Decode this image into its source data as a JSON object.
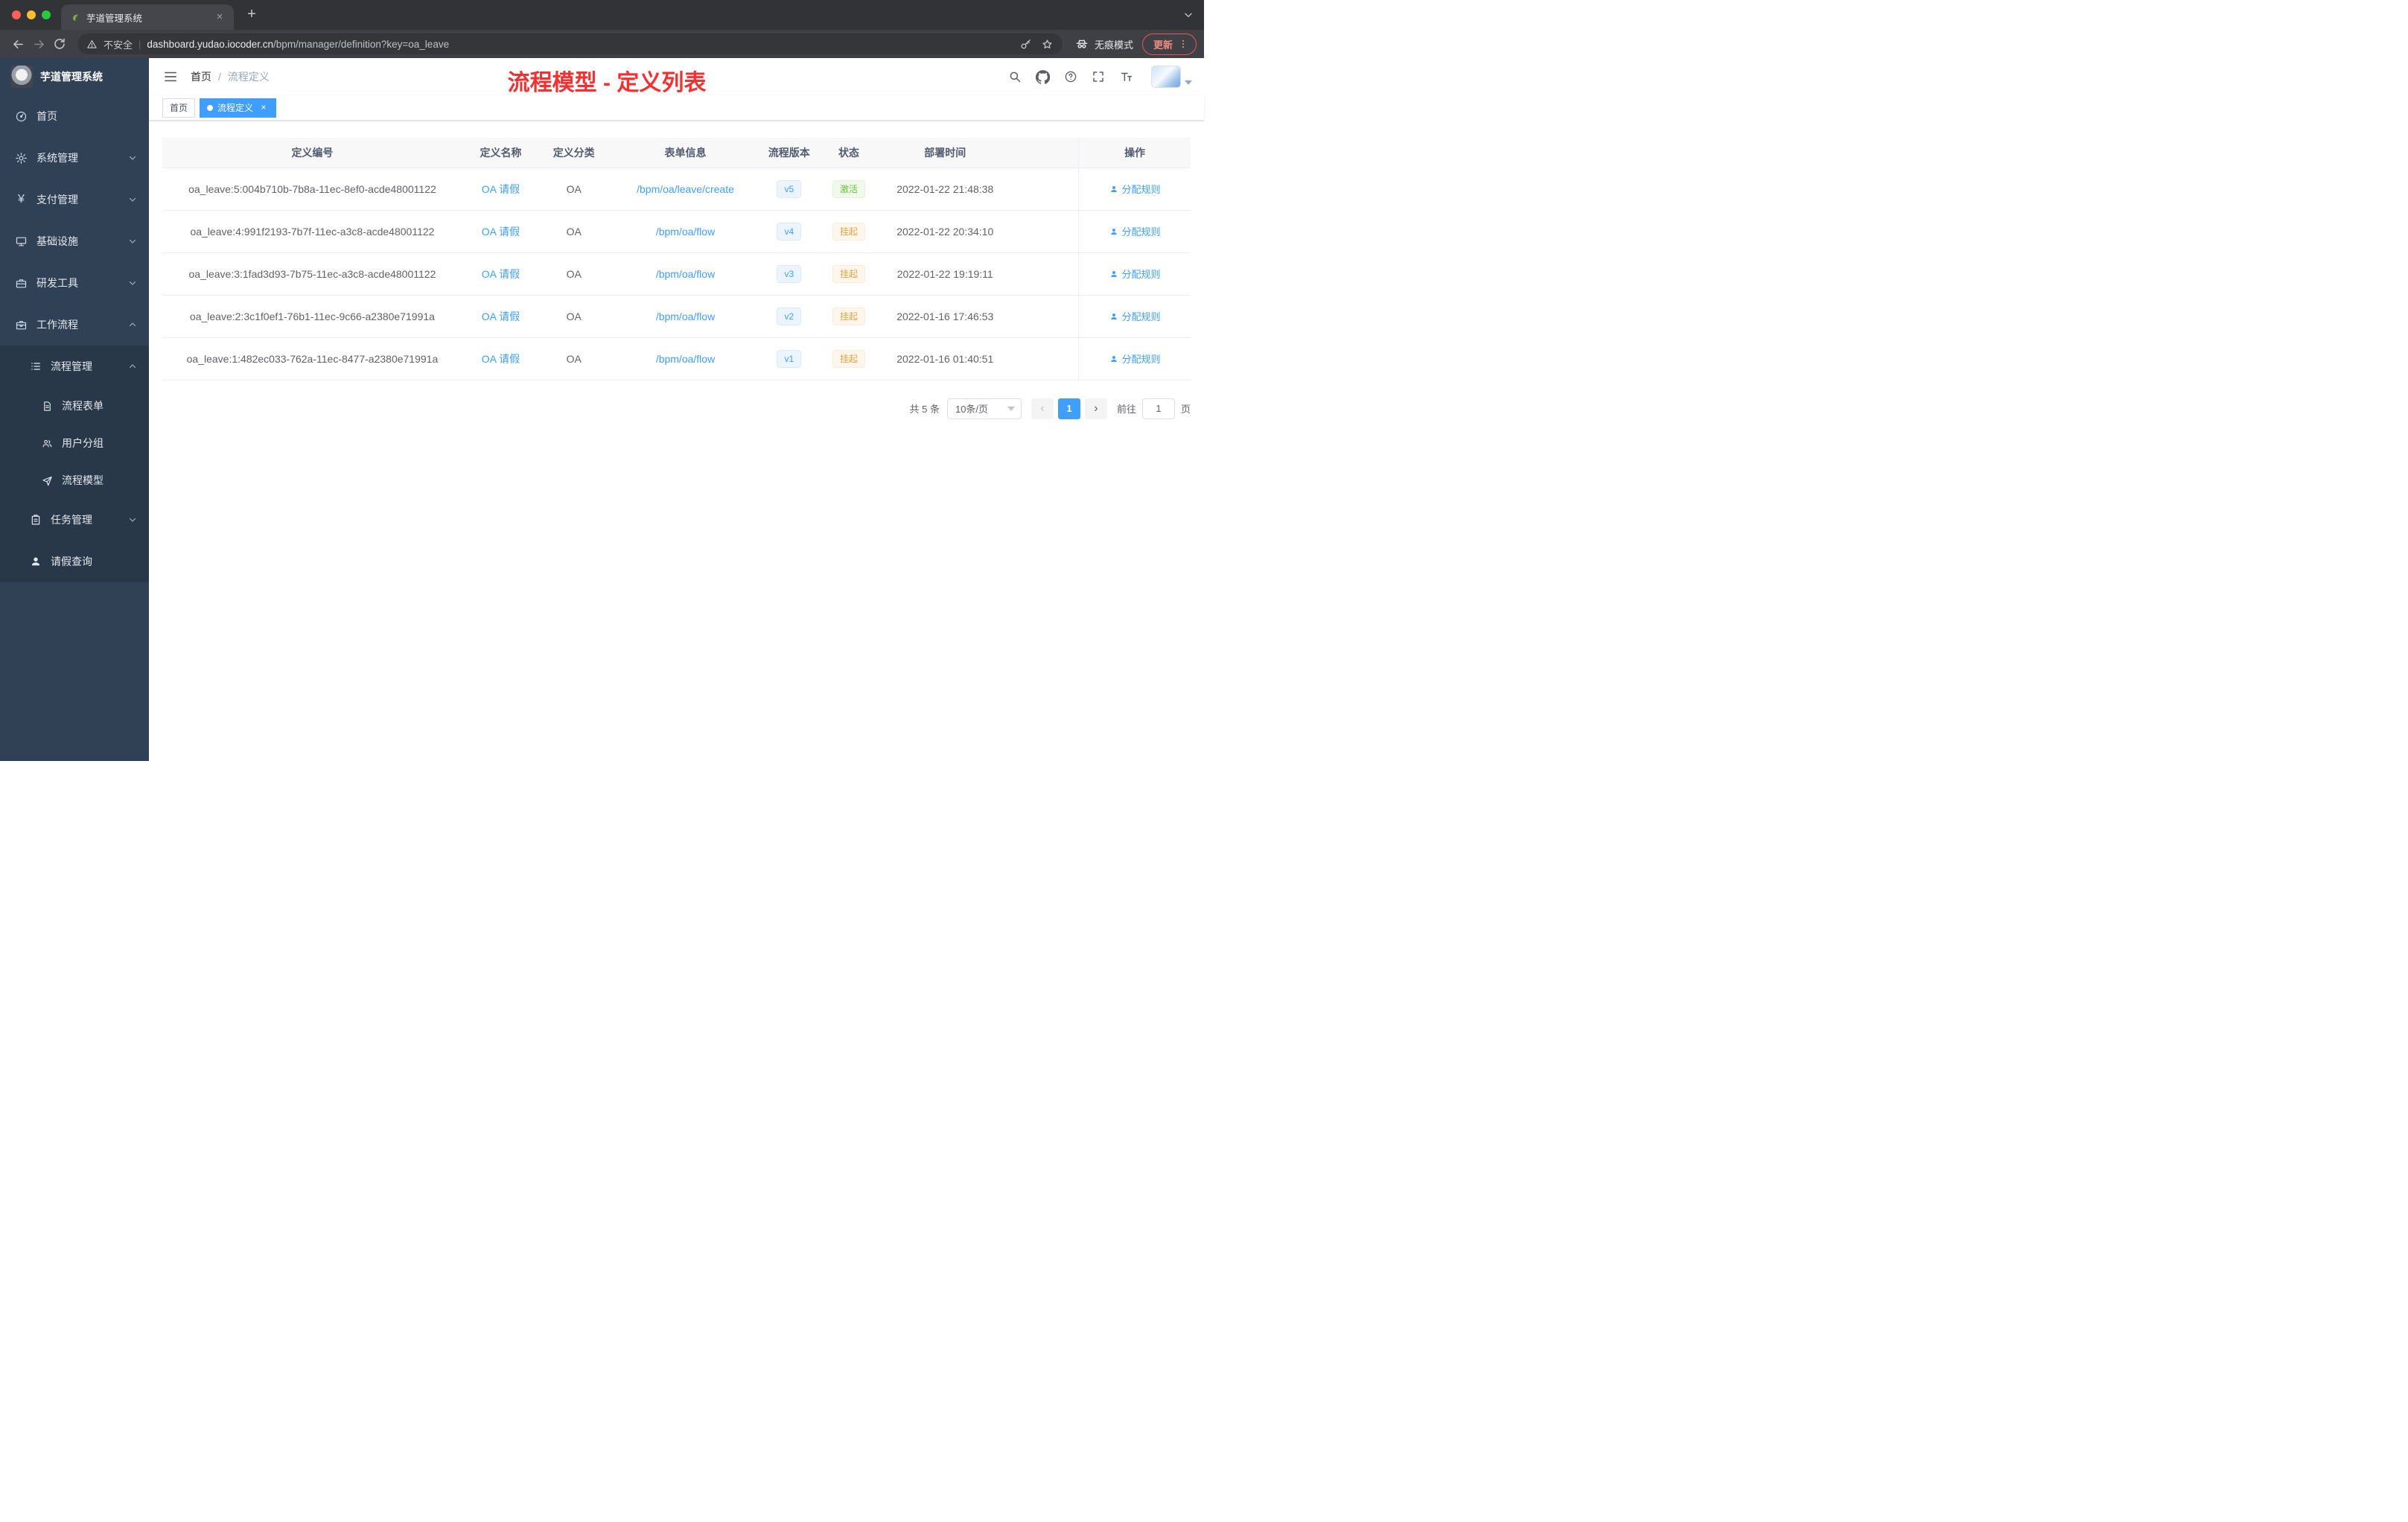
{
  "colors": {
    "accent": "#409eff",
    "success": "#67c23a",
    "warning": "#e6a23c",
    "annotation_red": "#f43030",
    "sidebar_bg": "#304156",
    "submenu_bg": "#283848"
  },
  "browser": {
    "traffic_lights": [
      "#ff5f57",
      "#febc2e",
      "#28c840"
    ],
    "tab_title": "芋道管理系统",
    "close_icon": "×",
    "new_tab_icon": "+",
    "security_label": "不安全",
    "separator": "|",
    "url_host": "dashboard.yudao.iocoder.cn",
    "url_path": "/bpm/manager/definition?key=oa_leave",
    "incognito_label": "无痕模式",
    "update_label": "更新"
  },
  "sidebar": {
    "brand": "芋道管理系统",
    "menu": [
      {
        "label": "首页"
      },
      {
        "label": "系统管理"
      },
      {
        "label": "支付管理"
      },
      {
        "label": "基础设施"
      },
      {
        "label": "研发工具"
      },
      {
        "label": "工作流程"
      }
    ],
    "yen_symbol": "¥",
    "submenu": {
      "process_management": "流程管理",
      "children": [
        {
          "label": "流程表单"
        },
        {
          "label": "用户分组"
        },
        {
          "label": "流程模型"
        }
      ],
      "task_management": "任务管理",
      "leave_query": "请假查询"
    }
  },
  "navbar": {
    "breadcrumb_home": "首页",
    "breadcrumb_separator": "/",
    "breadcrumb_current": "流程定义",
    "annotation": "流程模型 - 定义列表"
  },
  "tags": {
    "home": "首页",
    "active": "流程定义",
    "close_icon": "×"
  },
  "table": {
    "columns": [
      "定义编号",
      "定义名称",
      "定义分类",
      "表单信息",
      "流程版本",
      "状态",
      "部署时间",
      "操作"
    ],
    "rows": [
      {
        "id": "oa_leave:5:004b710b-7b8a-11ec-8ef0-acde48001122",
        "name": "OA 请假",
        "category": "OA",
        "form": "/bpm/oa/leave/create",
        "version": "v5",
        "status": "激活",
        "time": "2022-01-22 21:48:38",
        "action": "分配规则"
      },
      {
        "id": "oa_leave:4:991f2193-7b7f-11ec-a3c8-acde48001122",
        "name": "OA 请假",
        "category": "OA",
        "form": "/bpm/oa/flow",
        "version": "v4",
        "status": "挂起",
        "time": "2022-01-22 20:34:10",
        "action": "分配规则"
      },
      {
        "id": "oa_leave:3:1fad3d93-7b75-11ec-a3c8-acde48001122",
        "name": "OA 请假",
        "category": "OA",
        "form": "/bpm/oa/flow",
        "version": "v3",
        "status": "挂起",
        "time": "2022-01-22 19:19:11",
        "action": "分配规则"
      },
      {
        "id": "oa_leave:2:3c1f0ef1-76b1-11ec-9c66-a2380e71991a",
        "name": "OA 请假",
        "category": "OA",
        "form": "/bpm/oa/flow",
        "version": "v2",
        "status": "挂起",
        "time": "2022-01-16 17:46:53",
        "action": "分配规则"
      },
      {
        "id": "oa_leave:1:482ec033-762a-11ec-8477-a2380e71991a",
        "name": "OA 请假",
        "category": "OA",
        "form": "/bpm/oa/flow",
        "version": "v1",
        "status": "挂起",
        "time": "2022-01-16 01:40:51",
        "action": "分配规则"
      }
    ]
  },
  "pagination": {
    "total": "共 5 条",
    "page_size": "10条/页",
    "prev_icon": "‹",
    "page": "1",
    "next_icon": "›",
    "goto_label": "前往",
    "goto_value": "1",
    "page_unit": "页"
  }
}
